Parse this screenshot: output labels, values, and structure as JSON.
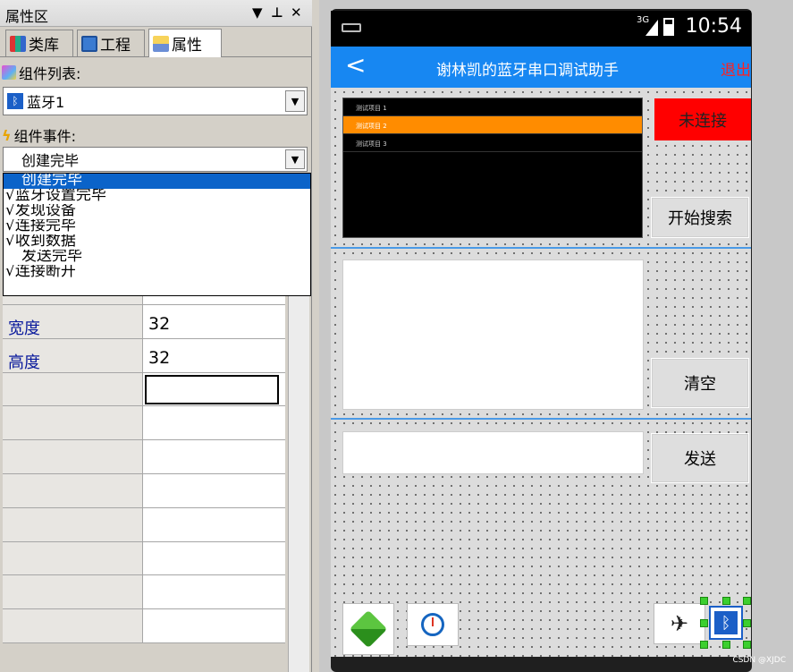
{
  "panel": {
    "title": "属性区",
    "controls": {
      "dropdown": "▼",
      "pin": "Ҹ",
      "close": "✕"
    },
    "tabs": [
      {
        "label": "类库"
      },
      {
        "label": "工程"
      },
      {
        "label": "属性"
      }
    ],
    "component_list_label": "组件列表:",
    "component_selected": "蓝牙1",
    "component_event_label": "组件事件:",
    "event_selected": "创建完毕",
    "event_options": [
      {
        "label": "创建完毕",
        "selected": true
      },
      {
        "label": "√蓝牙设置完毕",
        "selected": false
      },
      {
        "label": "√发现设备",
        "selected": false
      },
      {
        "label": "√连接完毕",
        "selected": false
      },
      {
        "label": "√收到数据",
        "selected": false
      },
      {
        "label": "发送完毕",
        "selected": false
      },
      {
        "label": "√连接断开",
        "selected": false
      }
    ],
    "properties": [
      {
        "name": "宽度",
        "value": "32"
      },
      {
        "name": "高度",
        "value": "32"
      }
    ]
  },
  "phone": {
    "status_time": "10:54",
    "status_network": "3G",
    "app_title": "谢林凯的蓝牙串口调试助手",
    "back_glyph": "<",
    "exit_label": "退出",
    "list_items": [
      "测试项目 1",
      "测试项目 2",
      "测试项目 3"
    ],
    "list_selected_index": 1,
    "status_button": "未连接",
    "search_button": "开始搜索",
    "clear_button": "清空",
    "send_button": "发送"
  },
  "colors": {
    "accent": "#1787f2",
    "status_red": "#ff0000",
    "list_highlight": "#ff8c00",
    "dropdown_select": "#0b63c9"
  },
  "watermark": "CSDN @XJDC"
}
